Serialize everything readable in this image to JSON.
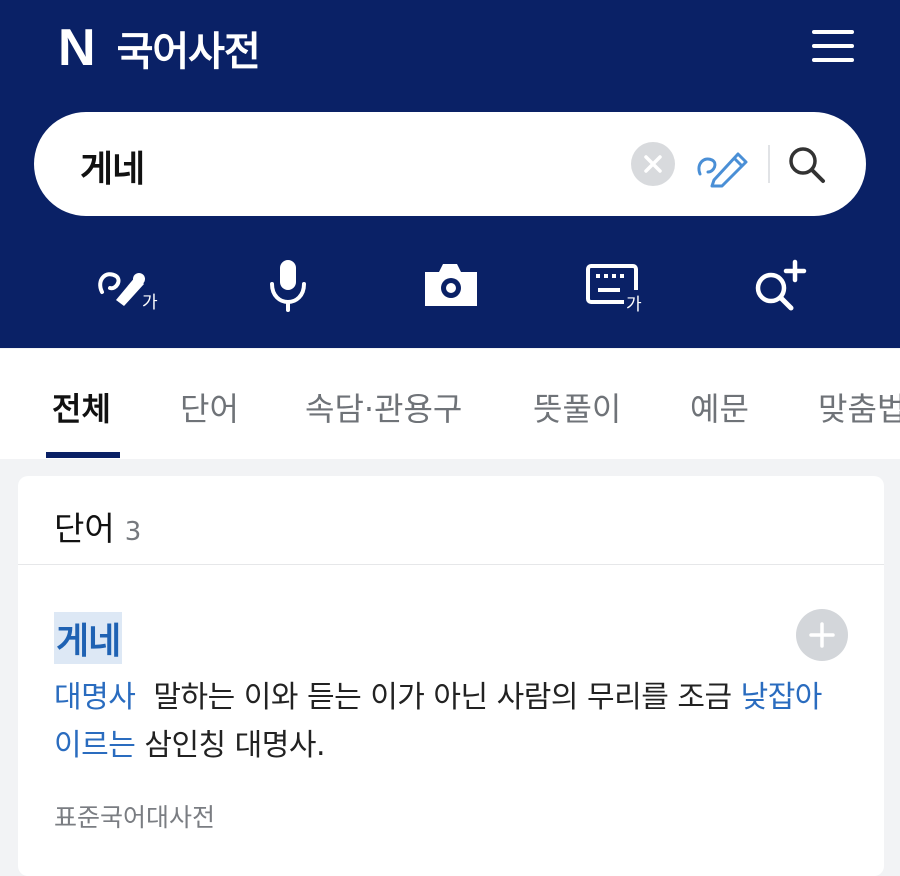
{
  "app": {
    "logo": "N",
    "title": "국어사전"
  },
  "header_icons": {
    "menu": "hamburger-menu-icon"
  },
  "search": {
    "value": "게네",
    "clear_icon": "clear-circle-icon",
    "handwrite_icon": "handwriting-pen-icon",
    "search_icon": "magnifier-icon"
  },
  "tools": [
    {
      "name": "handwriting-input-icon",
      "glyph": "가"
    },
    {
      "name": "microphone-icon"
    },
    {
      "name": "camera-icon"
    },
    {
      "name": "keyboard-input-icon",
      "glyph": "가"
    },
    {
      "name": "zoom-plus-icon"
    }
  ],
  "tabs": [
    {
      "label": "전체",
      "active": true
    },
    {
      "label": "단어"
    },
    {
      "label": "속담·관용구"
    },
    {
      "label": "뜻풀이"
    },
    {
      "label": "예문"
    },
    {
      "label": "맞춤법"
    }
  ],
  "section": {
    "title": "단어",
    "count": "3"
  },
  "entry": {
    "word": "게네",
    "pos": "대명사",
    "definition_part1": "말하는 이와 듣는 이가 아닌 사람의 무리를 조금 ",
    "link1": "낮잡아 이르는",
    "definition_part2": " 삼인칭 대명사.",
    "source": "표준국어대사전"
  },
  "colors": {
    "header_bg": "#0a2166",
    "accent_blue": "#2a6cbf",
    "page_bg": "#f2f3f5"
  }
}
